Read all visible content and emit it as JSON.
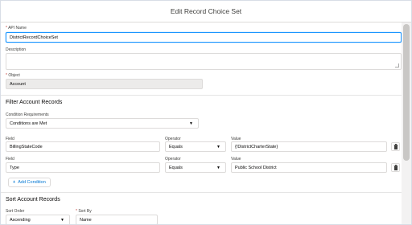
{
  "dialog": {
    "title": "Edit Record Choice Set"
  },
  "api_name": {
    "label": "API Name",
    "required": "*",
    "value": "DistrictRecordChoiceSet"
  },
  "description": {
    "label": "Description",
    "value": ""
  },
  "object": {
    "label": "Object",
    "required": "*",
    "value": "Account"
  },
  "filter": {
    "heading": "Filter Account Records",
    "condition_label": "Condition Requirements",
    "condition_value": "Conditions are Met",
    "rows": [
      {
        "field_label": "Field",
        "field": "BillingStateCode",
        "operator_label": "Operator",
        "operator": "Equals",
        "value_label": "Value",
        "value": "{!DistrictCharterState}"
      },
      {
        "field_label": "Field",
        "field": "Type",
        "operator_label": "Operator",
        "operator": "Equals",
        "value_label": "Value",
        "value": "Public School District"
      }
    ],
    "add_condition": "Add Condition",
    "add_icon": "+"
  },
  "sort": {
    "heading": "Sort Account Records",
    "order_label": "Sort Order",
    "order_value": "Ascending",
    "by_label": "Sort By",
    "by_required": "*",
    "by_value": "Name"
  },
  "icons": {
    "dropdown": "chevron-down-icon",
    "delete": "trash-icon"
  },
  "colors": {
    "focus": "#1b96ff",
    "required": "#c23934",
    "link": "#0176d3"
  }
}
